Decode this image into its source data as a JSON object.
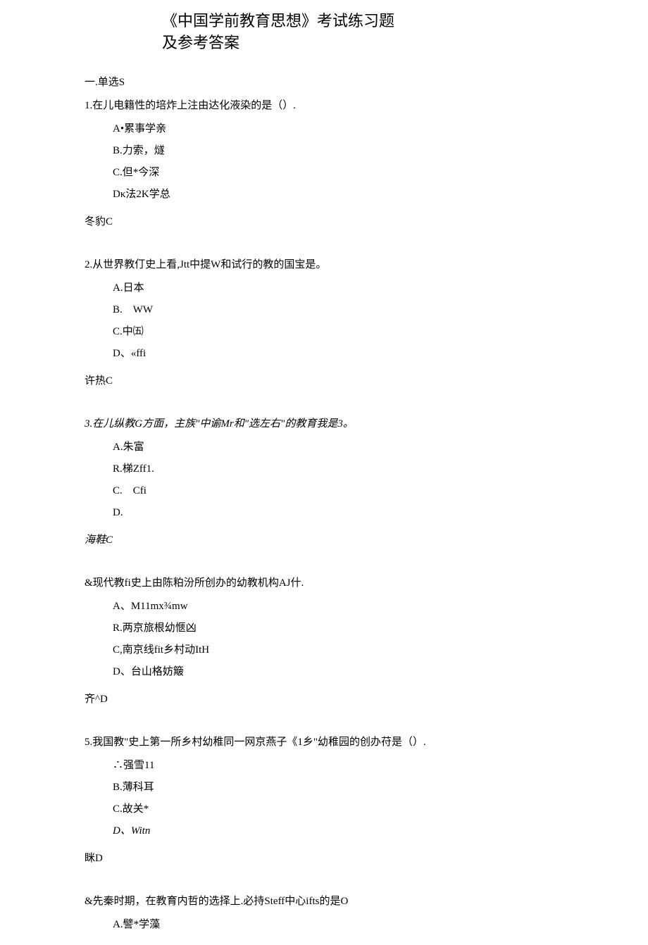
{
  "title_line1": "《中国学前教育思想》考试练习题",
  "title_line2": "及参考答案",
  "section_header": "一.单选S",
  "questions": [
    {
      "text": "1.在儿电籍性的培炸上注由达化液染的是（）.",
      "options": {
        "a": "A•累事学亲",
        "b": "B.力索，燧",
        "c": "C.但*今深",
        "d": "Dκ法2K学总"
      },
      "answer": "冬豹C"
    },
    {
      "text": "2.从世界教仃史上看,Jtt中提W和试行的教的国宝是。",
      "options": {
        "a": "A.日本",
        "b": "B.　WW",
        "c": "C.中㈤",
        "d": "D、«ffi"
      },
      "answer": "许热C"
    },
    {
      "text": "3.在儿纵教G方面，主族\"中谕Mr和\"选左右\"的教育我是3。",
      "options": {
        "a": "A.朱富",
        "b": "R.梯Zff1.",
        "c": "C.　Cfi",
        "d": "D."
      },
      "answer": "海鞋C"
    },
    {
      "text": "&现代教fi史上由陈粕汾所创办的幼教机构AJ什.",
      "options": {
        "a": "A、M11mx¾mw",
        "b": "R.两京旅根幼愜凶",
        "c": "C,南京线fit乡村动ItH",
        "d": "D、台山格妨簸"
      },
      "answer": "齐^D"
    },
    {
      "text": "5.我国教\"史上第一所乡村幼稚同一网京燕子《1乡\"幼稚园的创办苻是（）.",
      "options": {
        "a": "∴强雪11",
        "b": "B.薄科耳",
        "c": "C.故关*",
        "d": "D、Witn"
      },
      "answer": "眯D"
    },
    {
      "text": "&先秦时期，在教育内哲的选择上.必持Steff中心ifts的是O",
      "options": {
        "a": "A.譬*学藻"
      },
      "answer": ""
    }
  ]
}
